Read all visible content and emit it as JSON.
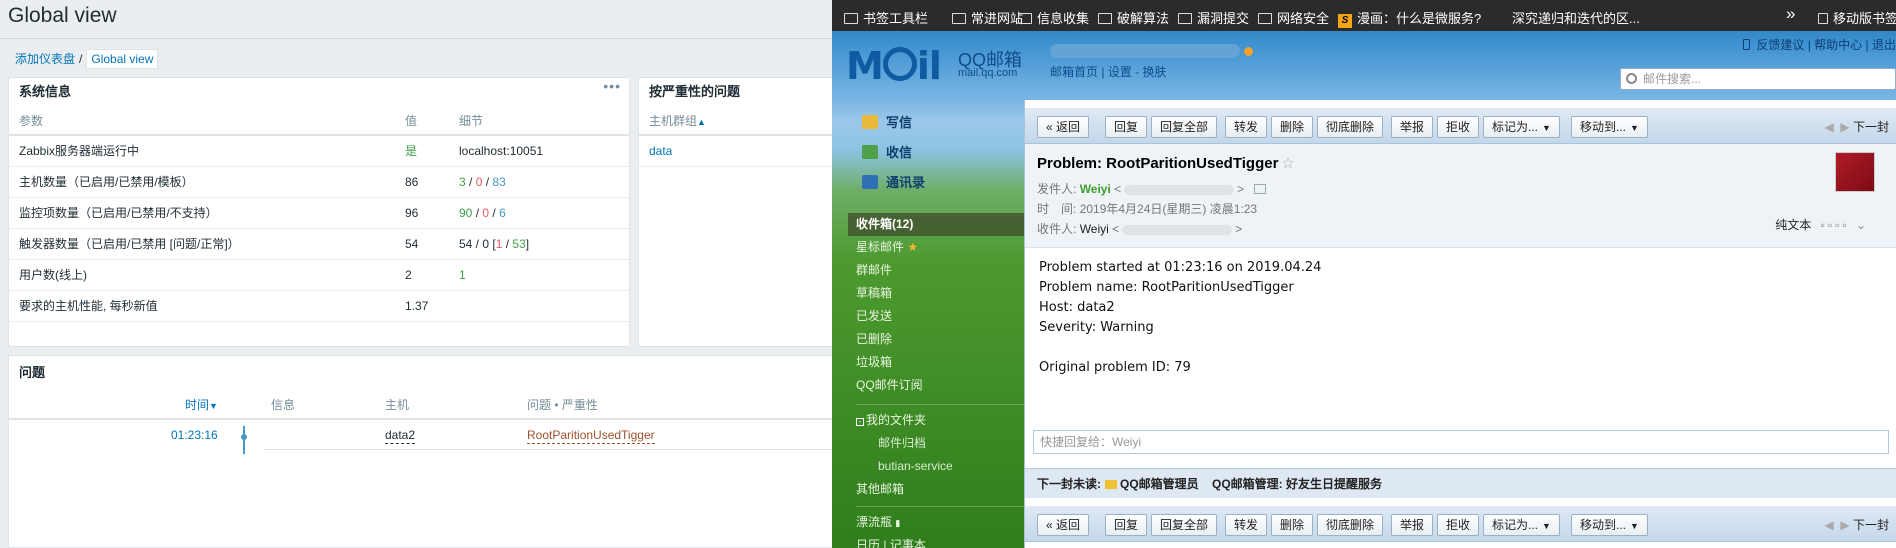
{
  "zabbix": {
    "page_title": "Global view",
    "breadcrumb": {
      "parent": "添加仪表盘",
      "separator": "/",
      "current": "Global view"
    },
    "sysinfo": {
      "title": "系统信息",
      "menu": "•••",
      "columns": [
        "参数",
        "值",
        "细节"
      ],
      "rows": [
        {
          "param": "Zabbix服务器端运行中",
          "value": "是",
          "detail": "localhost:10051"
        },
        {
          "param": "主机数量（已启用/已禁用/模板）",
          "value": "86",
          "d1": "3",
          "d2": "0",
          "d3": "83"
        },
        {
          "param": "监控项数量（已启用/已禁用/不支持）",
          "value": "96",
          "d1": "90",
          "d2": "0",
          "d3": "6"
        },
        {
          "param": "触发器数量（已启用/已禁用 [问题/正常]）",
          "value": "54",
          "d_prefix": "54 / 0 [",
          "d1": "1",
          "d_mid": " / ",
          "d2": "53",
          "d_suffix": "]"
        },
        {
          "param": "用户数(线上)",
          "value": "2",
          "d1": "1"
        },
        {
          "param": "要求的主机性能, 每秒新值",
          "value": "1.37"
        }
      ]
    },
    "severity": {
      "title": "按严重性的问题",
      "column": "主机群组",
      "sort": "▲",
      "group": "data"
    },
    "problems": {
      "title": "问题",
      "columns": {
        "time": "时间",
        "sort": "▼",
        "info": "信息",
        "host": "主机",
        "problem": "问题 • 严重性"
      },
      "rows": [
        {
          "time": "01:23:16",
          "host": "data2",
          "problem": "RootParitionUsedTigger"
        }
      ]
    }
  },
  "qq": {
    "bookmarks": {
      "items": [
        "书签工具栏",
        "常进网站",
        "信息收集",
        "破解算法",
        "漏洞提交",
        "网络安全"
      ],
      "badge": "S",
      "comic": "漫画：什么是微服务?",
      "article": "深究递归和迭代的区...",
      "more": "»",
      "mobile": "移动版书签"
    },
    "logo": "M",
    "logo_tail": "il",
    "brand": "QQ邮箱",
    "brand_url": "mail.qq.com",
    "acct_links": {
      "home": "邮箱首页",
      "settings": "设置",
      "switch": "换肤"
    },
    "top_links": {
      "feedback": "反馈建议",
      "help": "帮助中心",
      "logout": "退出"
    },
    "search_placeholder": "邮件搜索...",
    "compose": {
      "write": "写信",
      "receive": "收信",
      "contacts": "通讯录"
    },
    "folders": {
      "inbox": "收件箱(12)",
      "starred": "星标邮件",
      "group": "群邮件",
      "drafts": "草稿箱",
      "sent": "已发送",
      "deleted": "已删除",
      "spam": "垃圾箱",
      "subscriptions": "QQ邮件订阅",
      "my_folders": "我的文件夹",
      "archive": "邮件归档",
      "butian": "butian-service",
      "other": "其他邮箱",
      "drift": "漂流瓶",
      "calendar": "日历",
      "notes": "记事本"
    },
    "toolbar": {
      "back": "« 返回",
      "reply": "回复",
      "reply_all": "回复全部",
      "forward": "转发",
      "delete": "删除",
      "delete_perm": "彻底删除",
      "report": "举报",
      "reject": "拒收",
      "mark_as": "标记为...",
      "move_to": "移动到...",
      "next": "下一封"
    },
    "mail": {
      "subject": "Problem: RootParitionUsedTigger",
      "star": "☆",
      "from_label": "发件人:",
      "from_name": "Weiyi",
      "time_label": "时　间:",
      "time_value": "2019年4月24日(星期三) 凌晨1:23",
      "to_label": "收件人:",
      "to_name": "Weiyi",
      "plain_text": "纯文本",
      "body": [
        "Problem started at 01:23:16 on 2019.04.24",
        "Problem name: RootParitionUsedTigger",
        "Host: data2",
        "Severity: Warning",
        "",
        "Original problem ID: 79"
      ],
      "quick_reply": "快捷回复给：Weiyi",
      "next_unread_label": "下一封未读:",
      "next_unread_1": "QQ邮箱管理员",
      "next_unread_2": "QQ邮箱管理: 好友生日提醒服务"
    }
  }
}
